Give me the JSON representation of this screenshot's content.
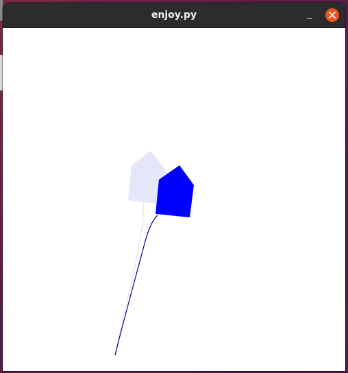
{
  "window": {
    "title": "enjoy.py"
  },
  "colors": {
    "titlebar": "#2c2c2c",
    "close_button": "#e95420",
    "kite_active": "#0000ff",
    "kite_ghost": "#e6e6fa",
    "tether_active": "#00008b",
    "tether_ghost": "#d8d8e8",
    "canvas": "#ffffff"
  },
  "icons": {
    "minimize": "minimize-icon",
    "close": "close-icon"
  }
}
